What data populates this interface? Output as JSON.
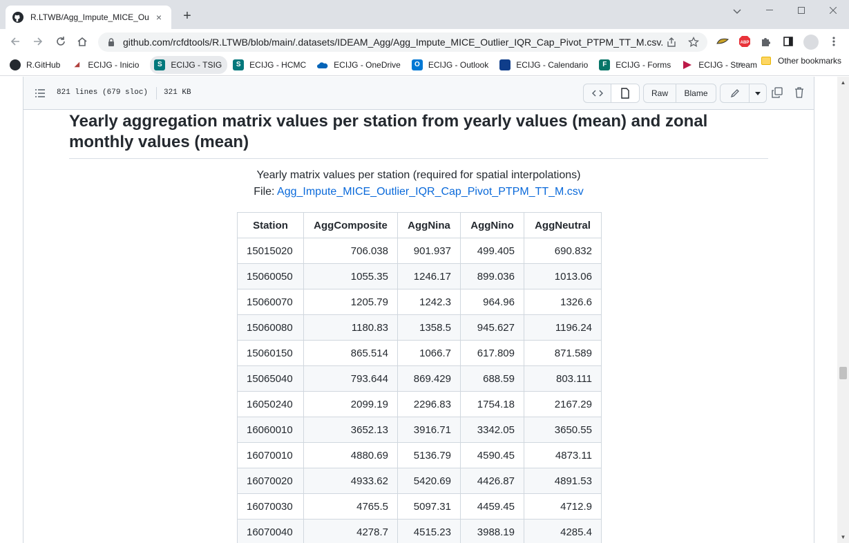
{
  "browser": {
    "tab_title": "R.LTWB/Agg_Impute_MICE_Outlier_",
    "url": "github.com/rcfdtools/R.LTWB/blob/main/.datasets/IDEAM_Agg/Agg_Impute_MICE_Outlier_IQR_Cap_Pivot_PTPM_TT_M.csv.md",
    "new_tab_label": "+",
    "close_tab_label": "×",
    "bookmarks": [
      {
        "label": "R.GitHub",
        "icon": "github-icon",
        "color": "#24292f"
      },
      {
        "label": "ECIJG - Inicio",
        "icon": "ecijg-icon",
        "color": "#b0413e"
      },
      {
        "label": "ECIJG - TSIG",
        "icon": "sharepoint-icon",
        "color": "#03787c"
      },
      {
        "label": "ECIJG - HCMC",
        "icon": "sharepoint-icon",
        "color": "#03787c"
      },
      {
        "label": "ECIJG - OneDrive",
        "icon": "onedrive-icon",
        "color": "#0364b8"
      },
      {
        "label": "ECIJG - Outlook",
        "icon": "outlook-icon",
        "color": "#0078d4"
      },
      {
        "label": "ECIJG - Calendario",
        "icon": "calendar-icon",
        "color": "#0f3d8a"
      },
      {
        "label": "ECIJG - Forms",
        "icon": "forms-icon",
        "color": "#077568"
      },
      {
        "label": "ECIJG - Stream",
        "icon": "stream-icon",
        "color": "#bc1948"
      }
    ],
    "bookmarks_more": "»",
    "other_bookmarks": "Other bookmarks"
  },
  "file": {
    "lines": "821 lines (679 sloc)",
    "size": "321 KB",
    "raw_label": "Raw",
    "blame_label": "Blame"
  },
  "content": {
    "heading": "Yearly aggregation matrix values per station from yearly values (mean) and zonal monthly values (mean)",
    "caption": "Yearly matrix values per station (required for spatial interpolations)",
    "file_prefix": "File: ",
    "file_link": "Agg_Impute_MICE_Outlier_IQR_Cap_Pivot_PTPM_TT_M.csv"
  },
  "table": {
    "headers": [
      "Station",
      "AggComposite",
      "AggNina",
      "AggNino",
      "AggNeutral"
    ],
    "rows": [
      [
        "15015020",
        "706.038",
        "901.937",
        "499.405",
        "690.832"
      ],
      [
        "15060050",
        "1055.35",
        "1246.17",
        "899.036",
        "1013.06"
      ],
      [
        "15060070",
        "1205.79",
        "1242.3",
        "964.96",
        "1326.6"
      ],
      [
        "15060080",
        "1180.83",
        "1358.5",
        "945.627",
        "1196.24"
      ],
      [
        "15060150",
        "865.514",
        "1066.7",
        "617.809",
        "871.589"
      ],
      [
        "15065040",
        "793.644",
        "869.429",
        "688.59",
        "803.111"
      ],
      [
        "16050240",
        "2099.19",
        "2296.83",
        "1754.18",
        "2167.29"
      ],
      [
        "16060010",
        "3652.13",
        "3916.71",
        "3342.05",
        "3650.55"
      ],
      [
        "16070010",
        "4880.69",
        "5136.79",
        "4590.45",
        "4873.11"
      ],
      [
        "16070020",
        "4933.62",
        "5420.69",
        "4426.87",
        "4891.53"
      ],
      [
        "16070030",
        "4765.5",
        "5097.31",
        "4459.45",
        "4712.9"
      ],
      [
        "16070040",
        "4278.7",
        "4515.23",
        "3988.19",
        "4285.4"
      ]
    ]
  }
}
